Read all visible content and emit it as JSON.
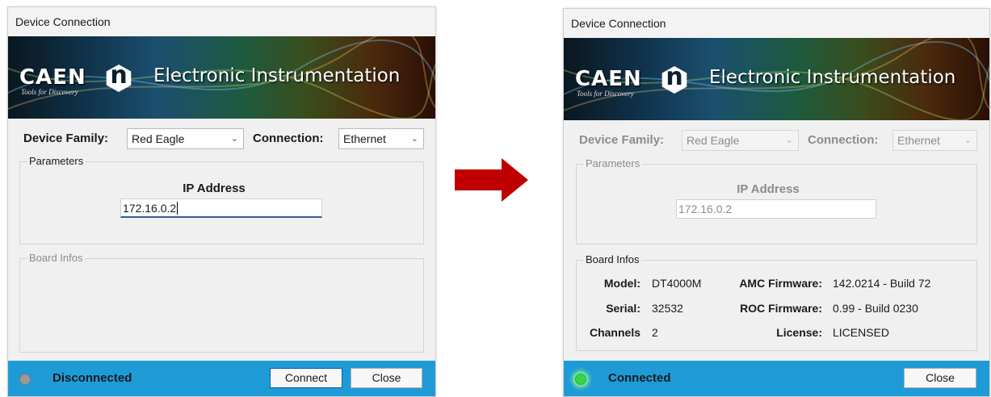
{
  "left_window": {
    "title": "Device Connection",
    "banner": {
      "brand": "CAEN",
      "tagline": "Tools for Discovery",
      "title": "Electronic Instrumentation"
    },
    "device_family_label": "Device Family:",
    "device_family_value": "Red Eagle",
    "connection_label": "Connection:",
    "connection_value": "Ethernet",
    "parameters_title": "Parameters",
    "ip_label": "IP Address",
    "ip_value": "172.16.0.2",
    "board_infos_title": "Board Infos",
    "status_text": "Disconnected",
    "connect_label": "Connect",
    "close_label": "Close"
  },
  "right_window": {
    "title": "Device Connection",
    "banner": {
      "brand": "CAEN",
      "tagline": "Tools for Discovery",
      "title": "Electronic Instrumentation"
    },
    "device_family_label": "Device Family:",
    "device_family_value": "Red Eagle",
    "connection_label": "Connection:",
    "connection_value": "Ethernet",
    "parameters_title": "Parameters",
    "ip_label": "IP Address",
    "ip_value": "172.16.0.2",
    "board_infos_title": "Board Infos",
    "board": {
      "model_label": "Model:",
      "model_value": "DT4000M",
      "serial_label": "Serial:",
      "serial_value": "32532",
      "channels_label": "Channels",
      "channels_value": "2",
      "amc_label": "AMC Firmware:",
      "amc_value": "142.0214 - Build 72",
      "roc_label": "ROC Firmware:",
      "roc_value": "0.99 - Build 0230",
      "license_label": "License:",
      "license_value": "LICENSED"
    },
    "status_text": "Connected",
    "close_label": "Close"
  },
  "colors": {
    "status_bar": "#1e9bd7",
    "led_disconnected": "#9a9a9a",
    "led_connected": "#39d44a",
    "arrow": "#c00000"
  },
  "icons": {
    "arrow": "right-arrow-icon",
    "led": "status-led-icon",
    "chevron": "chevron-down-icon"
  }
}
